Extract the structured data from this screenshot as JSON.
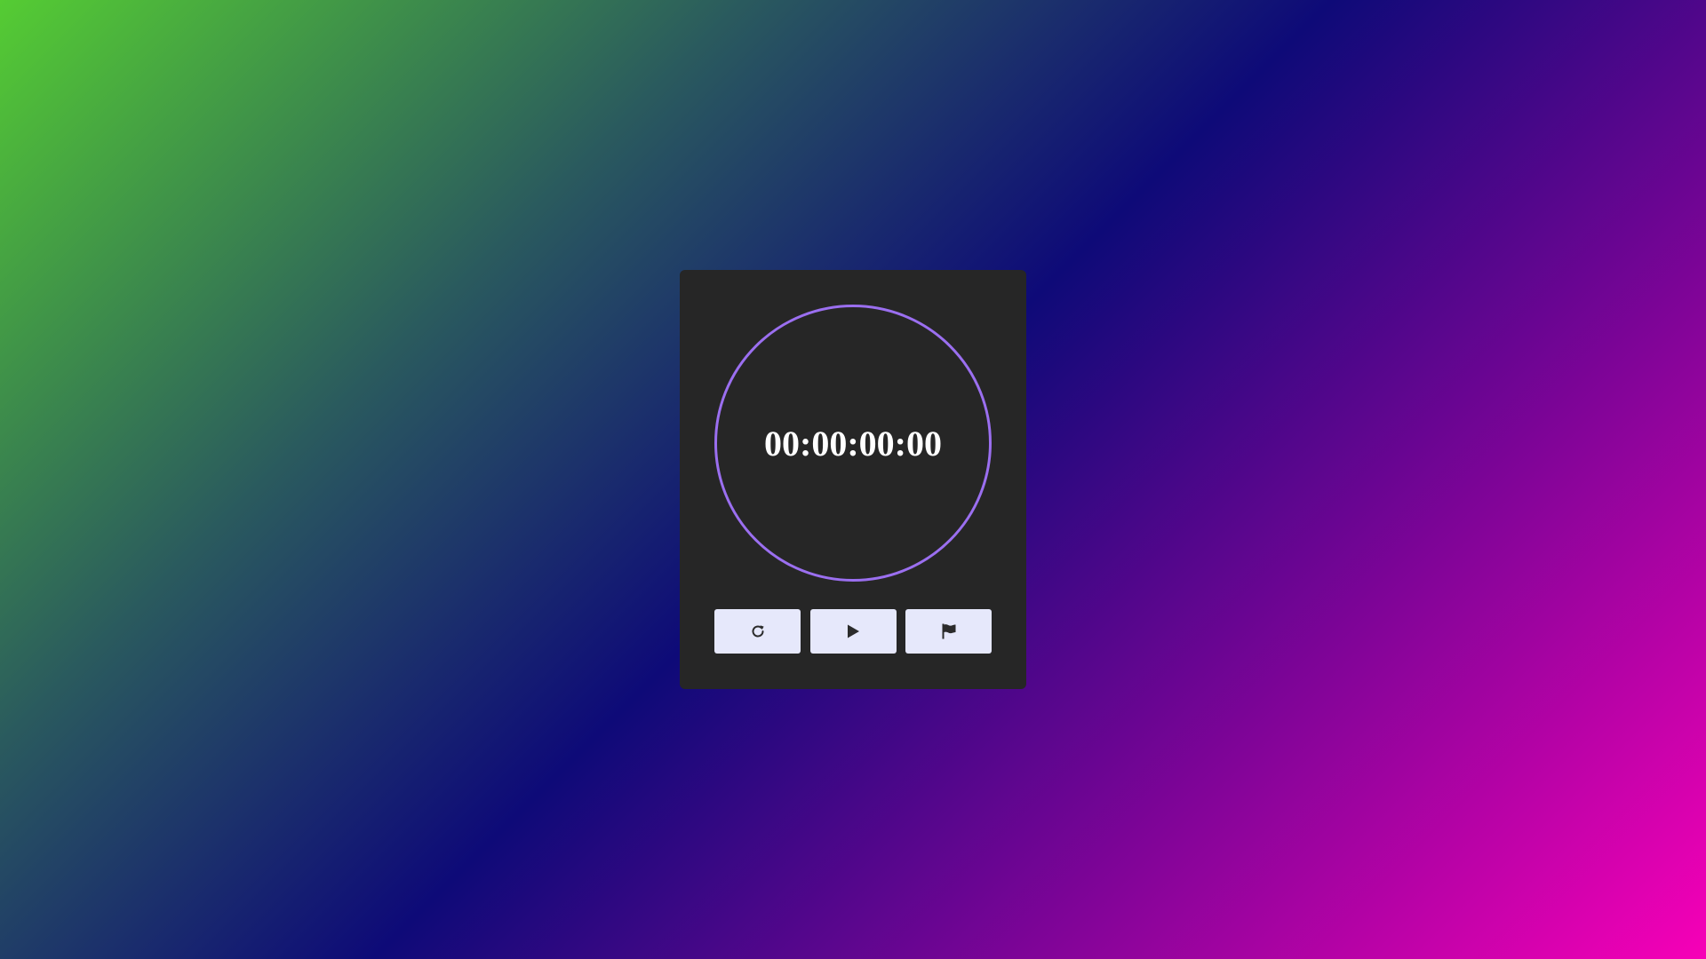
{
  "stopwatch": {
    "time": "00:00:00:00",
    "ring_color": "#9b6ff0"
  },
  "controls": [
    {
      "icon": "reset-icon"
    },
    {
      "icon": "play-icon"
    },
    {
      "icon": "flag-icon"
    }
  ]
}
